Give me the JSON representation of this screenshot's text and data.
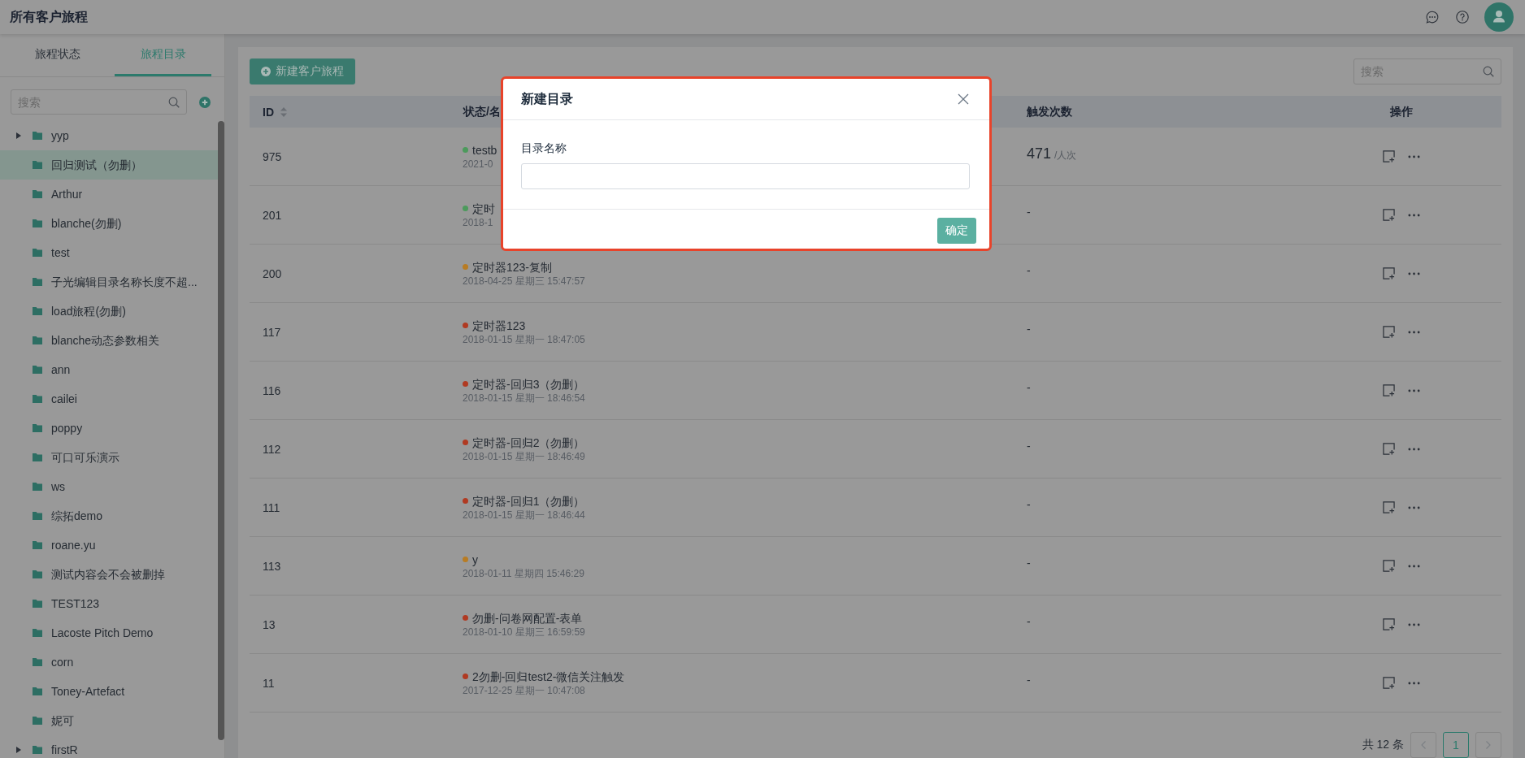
{
  "header": {
    "title": "所有客户旅程"
  },
  "sidebar": {
    "tabs": [
      {
        "label": "旅程状态",
        "selected": false
      },
      {
        "label": "旅程目录",
        "selected": true
      }
    ],
    "search": {
      "placeholder": "搜索"
    },
    "tree": [
      {
        "label": "yyp",
        "kind": "branch",
        "expanded": false,
        "selected": false
      },
      {
        "label": "回归测试（勿删）",
        "kind": "leaf",
        "selected": true
      },
      {
        "label": "Arthur",
        "kind": "leaf",
        "selected": false
      },
      {
        "label": "blanche(勿删)",
        "kind": "leaf",
        "selected": false
      },
      {
        "label": "test",
        "kind": "leaf",
        "selected": false
      },
      {
        "label": "子光编辑目录名称长度不超...",
        "kind": "leaf",
        "selected": false
      },
      {
        "label": "load旅程(勿删)",
        "kind": "leaf",
        "selected": false
      },
      {
        "label": "blanche动态参数相关",
        "kind": "leaf",
        "selected": false
      },
      {
        "label": "ann",
        "kind": "leaf",
        "selected": false
      },
      {
        "label": "cailei",
        "kind": "leaf",
        "selected": false
      },
      {
        "label": "poppy",
        "kind": "leaf",
        "selected": false
      },
      {
        "label": "可口可乐演示",
        "kind": "leaf",
        "selected": false
      },
      {
        "label": "ws",
        "kind": "leaf",
        "selected": false
      },
      {
        "label": "综拓demo",
        "kind": "leaf",
        "selected": false
      },
      {
        "label": "roane.yu",
        "kind": "leaf",
        "selected": false
      },
      {
        "label": "测试内容会不会被删掉",
        "kind": "leaf",
        "selected": false
      },
      {
        "label": "TEST123",
        "kind": "leaf",
        "selected": false
      },
      {
        "label": "Lacoste Pitch Demo",
        "kind": "leaf",
        "selected": false
      },
      {
        "label": "corn",
        "kind": "leaf",
        "selected": false
      },
      {
        "label": "Toney-Artefact",
        "kind": "leaf",
        "selected": false
      },
      {
        "label": "妮可",
        "kind": "leaf",
        "selected": false
      },
      {
        "label": "firstR",
        "kind": "branch",
        "expanded": false,
        "selected": false
      }
    ]
  },
  "main": {
    "new_button": "新建客户旅程",
    "search": {
      "placeholder": "搜索"
    },
    "table": {
      "columns": [
        {
          "label": "ID",
          "sortable": true
        },
        {
          "label": "状态/名",
          "sortable": false
        },
        {
          "label": "触发次数",
          "sortable": false
        },
        {
          "label": "操作",
          "sortable": false
        }
      ],
      "rows": [
        {
          "id": "975",
          "color": "#4c9a5c",
          "name": "testb",
          "date": "2021-0",
          "count": "471",
          "unit": "/人次"
        },
        {
          "id": "201",
          "color": "#4c9a5c",
          "name": "定时",
          "date": "2018-1",
          "count": "-"
        },
        {
          "id": "200",
          "color": "#b87c24",
          "name": "定时器123-复制",
          "date": "2018-04-25 星期三 15:47:57",
          "count": "-"
        },
        {
          "id": "117",
          "color": "#b03a22",
          "name": "定时器123",
          "date": "2018-01-15 星期一 18:47:05",
          "count": "-"
        },
        {
          "id": "116",
          "color": "#b03a22",
          "name": "定时器-回归3（勿删）",
          "date": "2018-01-15 星期一 18:46:54",
          "count": "-"
        },
        {
          "id": "112",
          "color": "#b03a22",
          "name": "定时器-回归2（勿删）",
          "date": "2018-01-15 星期一 18:46:49",
          "count": "-"
        },
        {
          "id": "111",
          "color": "#b03a22",
          "name": "定时器-回归1（勿删）",
          "date": "2018-01-15 星期一 18:46:44",
          "count": "-"
        },
        {
          "id": "113",
          "color": "#b87c24",
          "name": "y",
          "date": "2018-01-11 星期四 15:46:29",
          "count": "-"
        },
        {
          "id": "13",
          "color": "#b03a22",
          "name": "勿删-问卷网配置-表单",
          "date": "2018-01-10 星期三 16:59:59",
          "count": "-"
        },
        {
          "id": "11",
          "color": "#b03a22",
          "name": "2勿删-回归test2-微信关注触发",
          "date": "2017-12-25 星期一 10:47:08",
          "count": "-"
        }
      ]
    },
    "pagination": {
      "total": "共 12 条",
      "prev": {
        "disabled": true
      },
      "pages": [
        {
          "label": "1",
          "selected": true
        }
      ],
      "next": {
        "disabled": true
      }
    }
  },
  "dialog": {
    "title": "新建目录",
    "field_label": "目录名称",
    "confirm": "确定"
  }
}
